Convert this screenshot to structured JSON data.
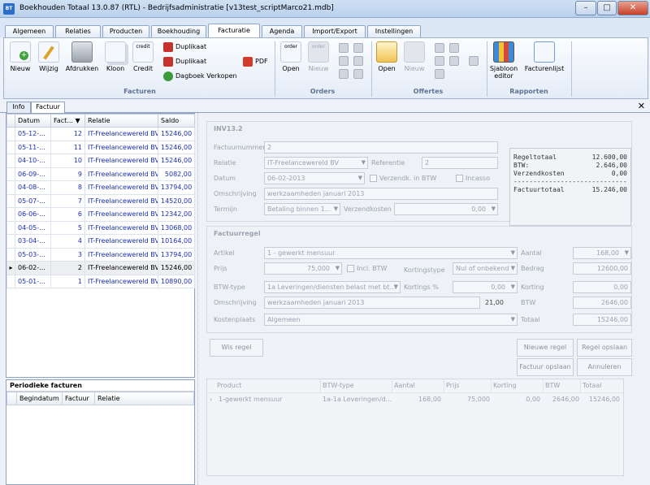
{
  "window": {
    "title": "Boekhouden Totaal 13.0.87 (RTL)  - Bedrijfsadministratie [v13test_scriptMarco21.mdb]",
    "app_icon_text": "BT"
  },
  "ribbon_tabs": [
    "Algemeen",
    "Relaties",
    "Producten",
    "Boekhouding",
    "Facturatie",
    "Agenda",
    "Import/Export",
    "Instellingen"
  ],
  "ribbon": {
    "facturen": {
      "group_label": "Facturen",
      "nieuw": "Nieuw",
      "wijzig": "Wijzig",
      "afdrukken": "Afdrukken",
      "kloon": "Kloon",
      "credit": "Credit",
      "credit_icon_text": "credit",
      "duplikaat1": "Duplikaat",
      "duplikaat2": "Duplikaat",
      "dagboek": "Dagboek Verkopen",
      "pdf": "PDF"
    },
    "orders": {
      "group_label": "Orders",
      "open": "Open",
      "nieuw": "Nieuw",
      "icon_text": "order"
    },
    "offertes": {
      "group_label": "Offertes",
      "open": "Open",
      "nieuw": "Nieuw"
    },
    "rapporten": {
      "group_label": "Rapporten",
      "sjabloon": "Sjabloon",
      "sjabloon2": "editor",
      "facturenlijst": "Facturenlijst"
    }
  },
  "doc_tabs": [
    "Info",
    "Factuur"
  ],
  "invoice_grid": {
    "columns": [
      "Datum",
      "Fact...",
      "Relatie",
      "Saldo"
    ],
    "rows": [
      {
        "datum": "05-12-...",
        "nr": "12",
        "relatie": "IT-Freelancewereld BV",
        "saldo": "15246,00"
      },
      {
        "datum": "05-11-...",
        "nr": "11",
        "relatie": "IT-Freelancewereld BV",
        "saldo": "15246,00"
      },
      {
        "datum": "04-10-...",
        "nr": "10",
        "relatie": "IT-Freelancewereld BV",
        "saldo": "15246,00"
      },
      {
        "datum": "06-09-...",
        "nr": "9",
        "relatie": "IT-Freelancewereld BV",
        "saldo": "5082,00"
      },
      {
        "datum": "04-08-...",
        "nr": "8",
        "relatie": "IT-Freelancewereld BV",
        "saldo": "13794,00"
      },
      {
        "datum": "05-07-...",
        "nr": "7",
        "relatie": "IT-Freelancewereld BV",
        "saldo": "14520,00"
      },
      {
        "datum": "06-06-...",
        "nr": "6",
        "relatie": "IT-Freelancewereld BV",
        "saldo": "12342,00"
      },
      {
        "datum": "04-05-...",
        "nr": "5",
        "relatie": "IT-Freelancewereld BV",
        "saldo": "13068,00"
      },
      {
        "datum": "03-04-...",
        "nr": "4",
        "relatie": "IT-Freelancewereld BV",
        "saldo": "10164,00"
      },
      {
        "datum": "05-03-...",
        "nr": "3",
        "relatie": "IT-Freelancewereld BV",
        "saldo": "13794,00"
      },
      {
        "datum": "06-02-...",
        "nr": "2",
        "relatie": "IT-Freelancewereld BV",
        "saldo": "15246,00"
      },
      {
        "datum": "05-01-...",
        "nr": "1",
        "relatie": "IT-Freelancewereld BV",
        "saldo": "10890,00"
      }
    ],
    "selected_index": 10
  },
  "periodiek": {
    "title": "Periodieke facturen",
    "columns": [
      "Begindatum",
      "Factuur",
      "Relatie"
    ]
  },
  "factuur": {
    "title": "INV13.2",
    "factuurnummer_label": "Factuurnummer",
    "factuurnummer": "2",
    "relatie_label": "Relatie",
    "relatie": "IT-Freelancewereld BV",
    "referentie_label": "Referentie",
    "referentie": "2",
    "datum_label": "Datum",
    "datum": "06-02-2013",
    "verzendk_label": "Verzendk. in BTW",
    "incasso_label": "Incasso",
    "omschrijving_label": "Omschrijving",
    "omschrijving": "werkzaamheden januari 2013",
    "termijn_label": "Termijn",
    "termijn": "Betaling binnen 1...",
    "verzendkosten_label": "Verzendkosten",
    "verzendkosten": "0,00"
  },
  "totals": {
    "regeltotaal_label": "Regeltotaal",
    "regeltotaal": "12.600,00",
    "btw_label": "BTW:",
    "btw": "2.646,00",
    "verzendkosten_label": "Verzendkosten",
    "verzendkosten": "0,00",
    "divider": "--------------------------------",
    "factuurtotaal_label": "Factuurtotaal",
    "factuurtotaal": "15.246,00"
  },
  "regel": {
    "title": "Factuurregel",
    "artikel_label": "Artikel",
    "artikel": "1 - gewerkt mensuur",
    "aantal_label": "Aantal",
    "aantal": "168,00",
    "prijs_label": "Prijs",
    "prijs": "75,000",
    "incl_btw_label": "Incl. BTW",
    "kortingstype_label": "Kortingstype",
    "kortingstype": "Nul of onbekend",
    "bedrag_label": "Bedrag",
    "bedrag": "12600,00",
    "btwtype_label": "BTW-type",
    "btwtype": "1a Leveringen/diensten belast met bt...",
    "kortings_label": "Kortings %",
    "kortings": "0,00",
    "korting_label": "Korting",
    "korting": "0,00",
    "omschrijving_label": "Omschrijving",
    "omschrijving": "werkzaamheden januari 2013",
    "btw_pct": "21,00",
    "btw_label": "BTW",
    "btw": "2646,00",
    "kostenplaats_label": "Kostenplaats",
    "kostenplaats": "Algemeen",
    "totaal_label": "Totaal",
    "totaal": "15246,00"
  },
  "buttons": {
    "wis_regel": "Wis regel",
    "nieuwe_regel": "Nieuwe regel",
    "regel_opslaan": "Regel opslaan",
    "factuur_opslaan": "Factuur opslaan",
    "annuleren": "Annuleren"
  },
  "lines_grid": {
    "columns": [
      "Product",
      "BTW-type",
      "Aantal",
      "Prijs",
      "Korting",
      "BTW",
      "Totaal"
    ],
    "row": {
      "product": "1-gewerkt mensuur",
      "btwtype": "1a-1a Leveringen/d...",
      "aantal": "168,00",
      "prijs": "75,000",
      "korting": "0,00",
      "btw": "2646,00",
      "totaal": "15246,00"
    }
  }
}
